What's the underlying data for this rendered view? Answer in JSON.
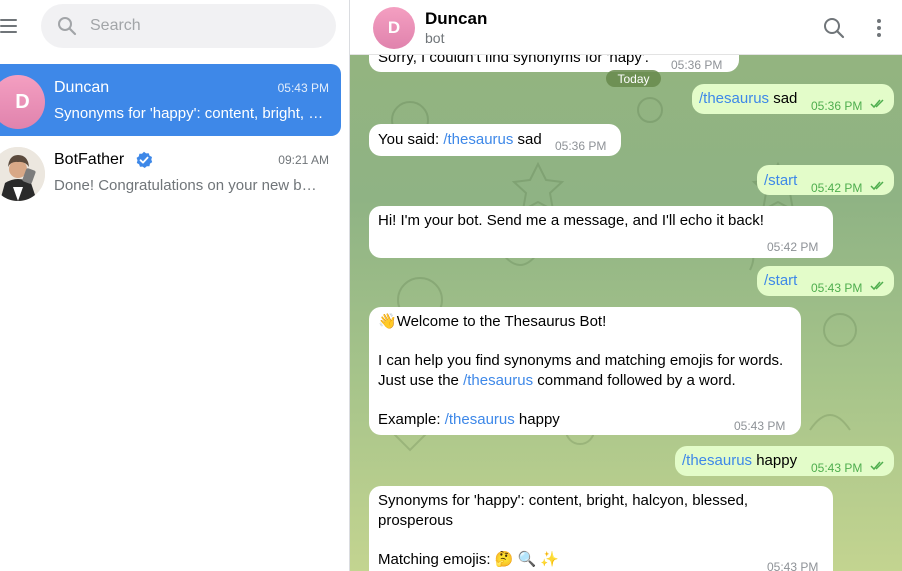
{
  "sidebar": {
    "search_placeholder": "Search",
    "chats": [
      {
        "name": "Duncan",
        "avatar_letter": "D",
        "time": "05:43 PM",
        "preview": "Synonyms for 'happy': content, bright, halcyon, blessed, prosperous",
        "active": true
      },
      {
        "name": "BotFather",
        "verified": true,
        "time": "09:21 AM",
        "preview": "Done! Congratulations on your new bot. You will find it at"
      }
    ]
  },
  "header": {
    "name": "Duncan",
    "status": "bot",
    "avatar_letter": "D"
  },
  "chat": {
    "date_separator": "Today",
    "messages": [
      {
        "dir": "in",
        "text": "Sorry, I couldn't find synonyms for 'hapy'.",
        "time": "05:36 PM"
      },
      {
        "dir": "out",
        "cmd": "/thesaurus",
        "rest": " sad",
        "time": "05:36 PM"
      },
      {
        "dir": "in",
        "prefix": "You said: ",
        "cmd": "/thesaurus",
        "rest": " sad",
        "time": "05:36 PM"
      },
      {
        "dir": "out",
        "cmd": "/start",
        "time": "05:42 PM"
      },
      {
        "dir": "in",
        "text": "Hi! I'm your bot. Send me a message, and I'll echo it back!",
        "time": "05:42 PM"
      },
      {
        "dir": "out",
        "cmd": "/start",
        "time": "05:43 PM"
      },
      {
        "dir": "in",
        "emoji": "👋",
        "line1": "Welcome to the Thesaurus Bot!",
        "line2": "I can help you find synonyms and matching emojis for words.",
        "line3_pre": "Just use the ",
        "line3_cmd": "/thesaurus",
        "line3_post": " command followed by a word.",
        "line4_pre": "Example: ",
        "line4_cmd": "/thesaurus",
        "line4_post": " happy",
        "time": "05:43 PM"
      },
      {
        "dir": "out",
        "cmd": "/thesaurus",
        "rest": " happy",
        "time": "05:43 PM"
      },
      {
        "dir": "in",
        "line1": "Synonyms for 'happy': content, bright, halcyon, blessed,",
        "line2": "prosperous",
        "line3": "Matching emojis: 🤔 🔍 ✨",
        "time": "05:43 PM"
      }
    ]
  },
  "colors": {
    "accent": "#3e88e8",
    "outgoing_bubble": "#e3fcc9",
    "incoming_bubble": "#ffffff",
    "tick_green": "#4fae4e"
  },
  "icons": [
    "menu-icon",
    "search-icon",
    "verified-badge-icon",
    "more-vertical-icon",
    "double-check-icon"
  ]
}
